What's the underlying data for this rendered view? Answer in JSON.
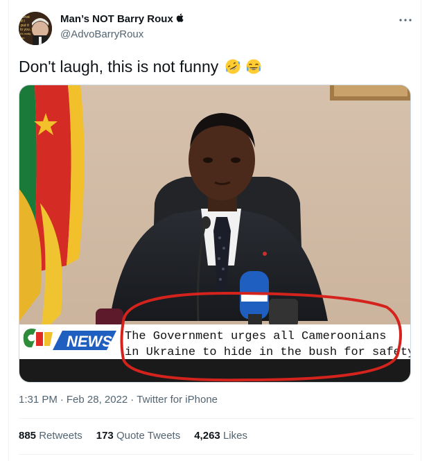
{
  "tweet": {
    "author": {
      "display_name": "Man’s NOT Barry Roux",
      "verified_badge_icon": "apple-icon",
      "handle": "@AdvoBarryRoux",
      "avatar_text": [
        "What",
        "if I",
        "put it",
        "to you..?",
        "it's really",
        "an"
      ]
    },
    "more_icon": "ellipsis-icon",
    "text": "Don't laugh, this is not funny",
    "emojis": [
      "rolling-on-floor-laughing-emoji",
      "tears-of-joy-emoji"
    ],
    "media": {
      "ticker_line1": "The Government urges all Cameroonians",
      "ticker_line2": "in Ukraine to hide in the bush for safety",
      "brand_news": "NEWS",
      "brand_logo": "crtv"
    },
    "time": "1:31 PM",
    "date": "Feb 28, 2022",
    "separator": "·",
    "source": "Twitter for iPhone",
    "stats": {
      "retweets_count": "885",
      "retweets_label": "Retweets",
      "quotes_count": "173",
      "quotes_label": "Quote Tweets",
      "likes_count": "4,263",
      "likes_label": "Likes"
    }
  }
}
